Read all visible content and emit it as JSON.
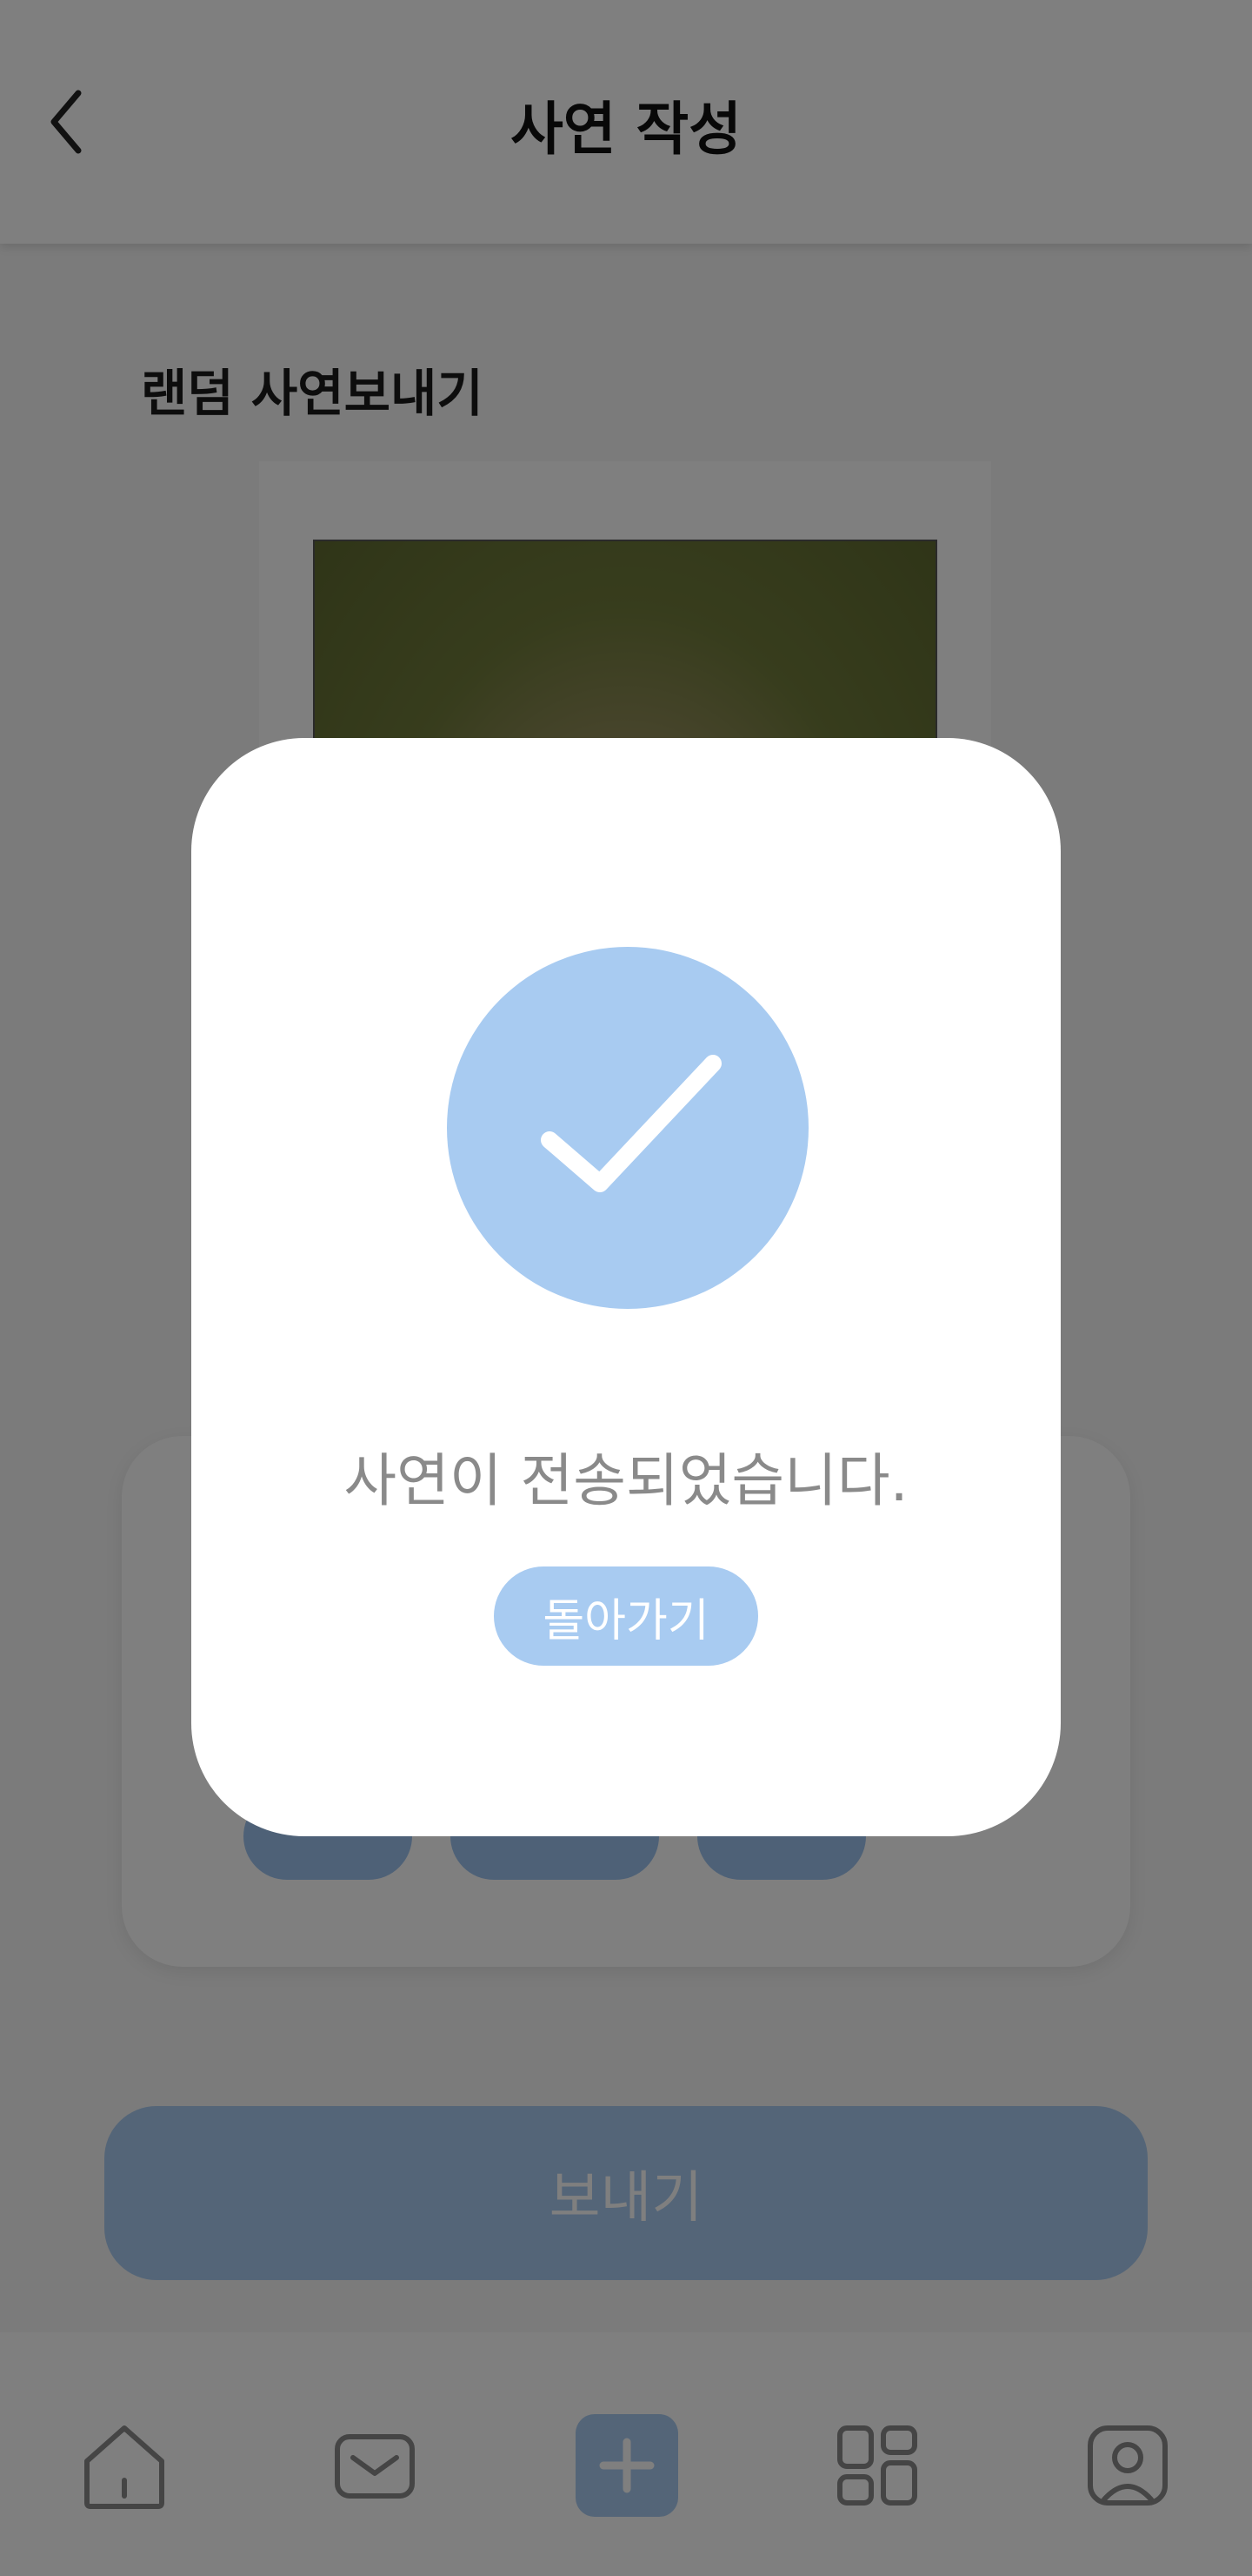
{
  "header": {
    "title": "사연 작성",
    "back_icon": "chevron-left-icon"
  },
  "section": {
    "title": "랜덤 사연보내기"
  },
  "photo": {
    "description_icon": "photo-thumbnail"
  },
  "tags": {
    "items": [
      "",
      "",
      ""
    ]
  },
  "send_button": {
    "label": "보내기"
  },
  "bottom_nav": {
    "items": [
      {
        "icon": "home-icon"
      },
      {
        "icon": "mail-icon"
      },
      {
        "icon": "plus-icon"
      },
      {
        "icon": "grid-icon"
      },
      {
        "icon": "profile-icon"
      }
    ]
  },
  "modal": {
    "icon": "check-circle-icon",
    "message": "사연이 전송되었습니다.",
    "back_label": "돌아가기"
  },
  "colors": {
    "accent": "#a8cbf1",
    "accent_dark": "#9cc3ef",
    "text_dark": "#111111",
    "text_muted": "#8a8a8a",
    "overlay": "rgba(0,0,0,0.5)"
  }
}
